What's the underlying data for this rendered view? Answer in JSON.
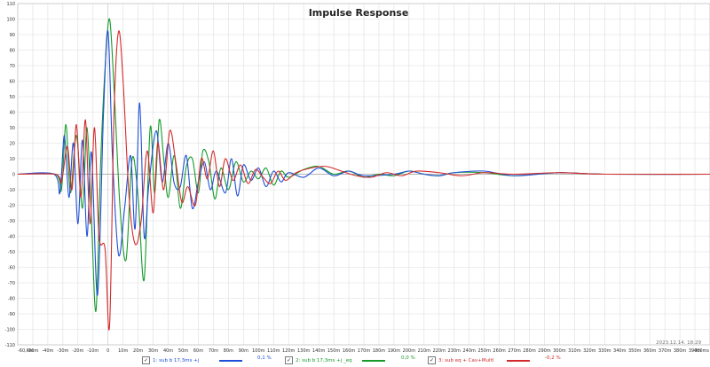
{
  "chart_data": {
    "type": "line",
    "title": "Impulse Response",
    "timestamp": "2023.12.14. 18:29",
    "xlabel": "",
    "ylabel": "",
    "xlim": [
      -0.06,
      0.4
    ],
    "ylim": [
      -110,
      110
    ],
    "grid": true,
    "x_tick_labels": [
      "-60,6m",
      "-50m",
      "-40m",
      "-30m",
      "-20m",
      "-10m",
      "0",
      "10m",
      "20m",
      "30m",
      "40m",
      "50m",
      "60m",
      "70m",
      "80m",
      "90m",
      "100m",
      "110m",
      "120m",
      "130m",
      "140m",
      "150m",
      "160m",
      "170m",
      "180m",
      "190m",
      "200m",
      "210m",
      "220m",
      "230m",
      "240m",
      "250m",
      "260m",
      "270m",
      "280m",
      "290m",
      "300m",
      "310m",
      "320m",
      "330m",
      "340m",
      "350m",
      "360m",
      "370m",
      "380m",
      "390m",
      "400ms"
    ],
    "y_tick_labels": [
      "110",
      "100",
      "90",
      "80",
      "70",
      "60",
      "50",
      "40",
      "30",
      "20",
      "10",
      "0",
      "-10",
      "-20",
      "-30",
      "-40",
      "-50",
      "-60",
      "-70",
      "-80",
      "-90",
      "-100",
      "-110"
    ],
    "y_unit": "%",
    "series": [
      {
        "name": "1: sub b 17,3ms +j",
        "color": "#1f4fd6",
        "percent": "0,1 %",
        "checked": true,
        "points": [
          [
            -0.06,
            0
          ],
          [
            -0.036,
            0
          ],
          [
            -0.032,
            -12
          ],
          [
            -0.029,
            25
          ],
          [
            -0.026,
            -15
          ],
          [
            -0.023,
            20
          ],
          [
            -0.02,
            -32
          ],
          [
            -0.017,
            22
          ],
          [
            -0.014,
            -40
          ],
          [
            -0.011,
            14
          ],
          [
            -0.007,
            -78
          ],
          [
            -0.003,
            40
          ],
          [
            0.0,
            92
          ],
          [
            0.003,
            10
          ],
          [
            0.007,
            -52
          ],
          [
            0.011,
            -22
          ],
          [
            0.015,
            12
          ],
          [
            0.018,
            -35
          ],
          [
            0.021,
            46
          ],
          [
            0.024,
            -40
          ],
          [
            0.027,
            -8
          ],
          [
            0.032,
            28
          ],
          [
            0.036,
            -5
          ],
          [
            0.04,
            20
          ],
          [
            0.044,
            -6
          ],
          [
            0.048,
            -8
          ],
          [
            0.052,
            12
          ],
          [
            0.056,
            -22
          ],
          [
            0.06,
            -5
          ],
          [
            0.064,
            8
          ],
          [
            0.068,
            -10
          ],
          [
            0.072,
            2
          ],
          [
            0.078,
            -12
          ],
          [
            0.082,
            10
          ],
          [
            0.086,
            -14
          ],
          [
            0.09,
            6
          ],
          [
            0.095,
            -4
          ],
          [
            0.1,
            4
          ],
          [
            0.105,
            -8
          ],
          [
            0.11,
            2
          ],
          [
            0.115,
            -5
          ],
          [
            0.12,
            1
          ],
          [
            0.13,
            -2
          ],
          [
            0.14,
            4
          ],
          [
            0.15,
            -1
          ],
          [
            0.16,
            2
          ],
          [
            0.17,
            -1
          ],
          [
            0.19,
            0
          ],
          [
            0.2,
            2
          ],
          [
            0.21,
            0
          ],
          [
            0.22,
            -1
          ],
          [
            0.23,
            1
          ],
          [
            0.25,
            2
          ],
          [
            0.27,
            -1
          ],
          [
            0.3,
            1
          ],
          [
            0.33,
            0
          ],
          [
            0.4,
            0
          ]
        ]
      },
      {
        "name": "2: sub b 17,3ms +j _eq",
        "color": "#159a2a",
        "percent": "0,0 %",
        "checked": true,
        "points": [
          [
            -0.06,
            0
          ],
          [
            -0.035,
            0
          ],
          [
            -0.031,
            -10
          ],
          [
            -0.028,
            32
          ],
          [
            -0.025,
            -12
          ],
          [
            -0.021,
            25
          ],
          [
            -0.017,
            -22
          ],
          [
            -0.014,
            30
          ],
          [
            -0.011,
            -30
          ],
          [
            -0.008,
            -88
          ],
          [
            -0.005,
            5
          ],
          [
            -0.002,
            68
          ],
          [
            0.001,
            100
          ],
          [
            0.004,
            55
          ],
          [
            0.008,
            -22
          ],
          [
            0.012,
            -55
          ],
          [
            0.016,
            10
          ],
          [
            0.02,
            -15
          ],
          [
            0.024,
            -68
          ],
          [
            0.028,
            30
          ],
          [
            0.031,
            -12
          ],
          [
            0.034,
            35
          ],
          [
            0.037,
            10
          ],
          [
            0.04,
            -15
          ],
          [
            0.044,
            12
          ],
          [
            0.048,
            -22
          ],
          [
            0.052,
            5
          ],
          [
            0.056,
            10
          ],
          [
            0.06,
            -12
          ],
          [
            0.063,
            15
          ],
          [
            0.067,
            8
          ],
          [
            0.071,
            -16
          ],
          [
            0.075,
            4
          ],
          [
            0.08,
            -10
          ],
          [
            0.085,
            8
          ],
          [
            0.09,
            -5
          ],
          [
            0.095,
            2
          ],
          [
            0.1,
            -3
          ],
          [
            0.105,
            4
          ],
          [
            0.11,
            -7
          ],
          [
            0.115,
            2
          ],
          [
            0.12,
            -2
          ],
          [
            0.13,
            3
          ],
          [
            0.14,
            5
          ],
          [
            0.15,
            0
          ],
          [
            0.16,
            2
          ],
          [
            0.17,
            -2
          ],
          [
            0.18,
            0
          ],
          [
            0.19,
            -1
          ],
          [
            0.2,
            2
          ],
          [
            0.21,
            0
          ],
          [
            0.22,
            -1
          ],
          [
            0.23,
            1
          ],
          [
            0.25,
            1
          ],
          [
            0.27,
            -1
          ],
          [
            0.3,
            1
          ],
          [
            0.33,
            0
          ],
          [
            0.4,
            0
          ]
        ]
      },
      {
        "name": "3: sub eq + Cav+MultI",
        "color": "#d42a2a",
        "percent": "-0,2 %",
        "checked": true,
        "points": [
          [
            -0.06,
            0
          ],
          [
            -0.035,
            0
          ],
          [
            -0.031,
            -5
          ],
          [
            -0.027,
            18
          ],
          [
            -0.024,
            -10
          ],
          [
            -0.021,
            32
          ],
          [
            -0.018,
            -15
          ],
          [
            -0.015,
            35
          ],
          [
            -0.012,
            -32
          ],
          [
            -0.009,
            30
          ],
          [
            -0.006,
            -40
          ],
          [
            -0.002,
            -48
          ],
          [
            0.001,
            -98
          ],
          [
            0.004,
            40
          ],
          [
            0.007,
            92
          ],
          [
            0.01,
            60
          ],
          [
            0.014,
            -15
          ],
          [
            0.018,
            -45
          ],
          [
            0.022,
            -30
          ],
          [
            0.026,
            15
          ],
          [
            0.03,
            -25
          ],
          [
            0.033,
            20
          ],
          [
            0.037,
            -10
          ],
          [
            0.041,
            28
          ],
          [
            0.045,
            8
          ],
          [
            0.049,
            -18
          ],
          [
            0.053,
            -8
          ],
          [
            0.058,
            -20
          ],
          [
            0.062,
            10
          ],
          [
            0.066,
            -3
          ],
          [
            0.07,
            15
          ],
          [
            0.074,
            -8
          ],
          [
            0.078,
            10
          ],
          [
            0.083,
            -4
          ],
          [
            0.088,
            6
          ],
          [
            0.093,
            -6
          ],
          [
            0.098,
            3
          ],
          [
            0.103,
            -2
          ],
          [
            0.108,
            -6
          ],
          [
            0.113,
            2
          ],
          [
            0.118,
            -4
          ],
          [
            0.125,
            1
          ],
          [
            0.135,
            4
          ],
          [
            0.145,
            5
          ],
          [
            0.155,
            2
          ],
          [
            0.165,
            -1
          ],
          [
            0.175,
            -2
          ],
          [
            0.185,
            1
          ],
          [
            0.195,
            -1
          ],
          [
            0.205,
            2
          ],
          [
            0.22,
            1
          ],
          [
            0.235,
            -1
          ],
          [
            0.25,
            1
          ],
          [
            0.27,
            0
          ],
          [
            0.3,
            1
          ],
          [
            0.33,
            0
          ],
          [
            0.4,
            0
          ]
        ]
      }
    ]
  }
}
